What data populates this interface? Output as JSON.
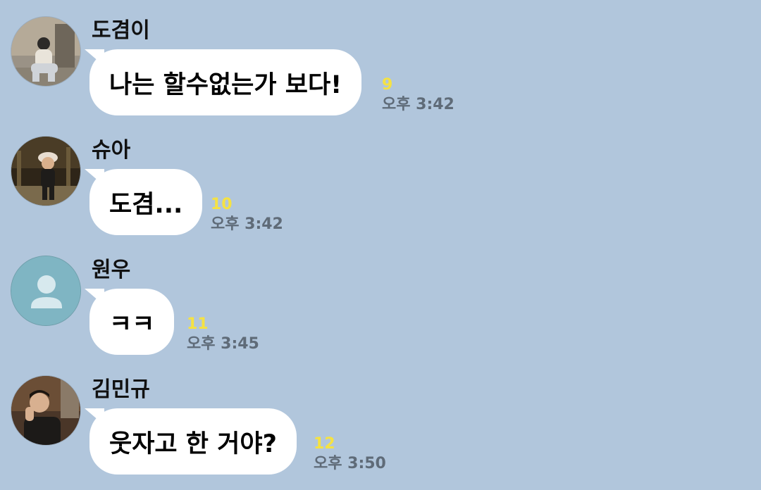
{
  "messages": [
    {
      "sender": "도겸이",
      "text": "나는 할수없는가 보다!",
      "unread": "9",
      "time": "오후 3:42",
      "avatar": "photo-person-sitting"
    },
    {
      "sender": "슈아",
      "text": "도겸...",
      "unread": "10",
      "time": "오후 3:42",
      "avatar": "photo-child-with-hat"
    },
    {
      "sender": "원우",
      "text": "ㅋㅋ",
      "unread": "11",
      "time": "오후 3:45",
      "avatar": "default-person-icon"
    },
    {
      "sender": "김민규",
      "text": "웃자고 한 거야?",
      "unread": "12",
      "time": "오후 3:50",
      "avatar": "photo-person-portrait"
    }
  ],
  "colors": {
    "background": "#b1c6dc",
    "bubble": "#ffffff",
    "unread": "#f5e243",
    "time": "#5f6b78",
    "default_avatar": "#7fb5c3"
  }
}
